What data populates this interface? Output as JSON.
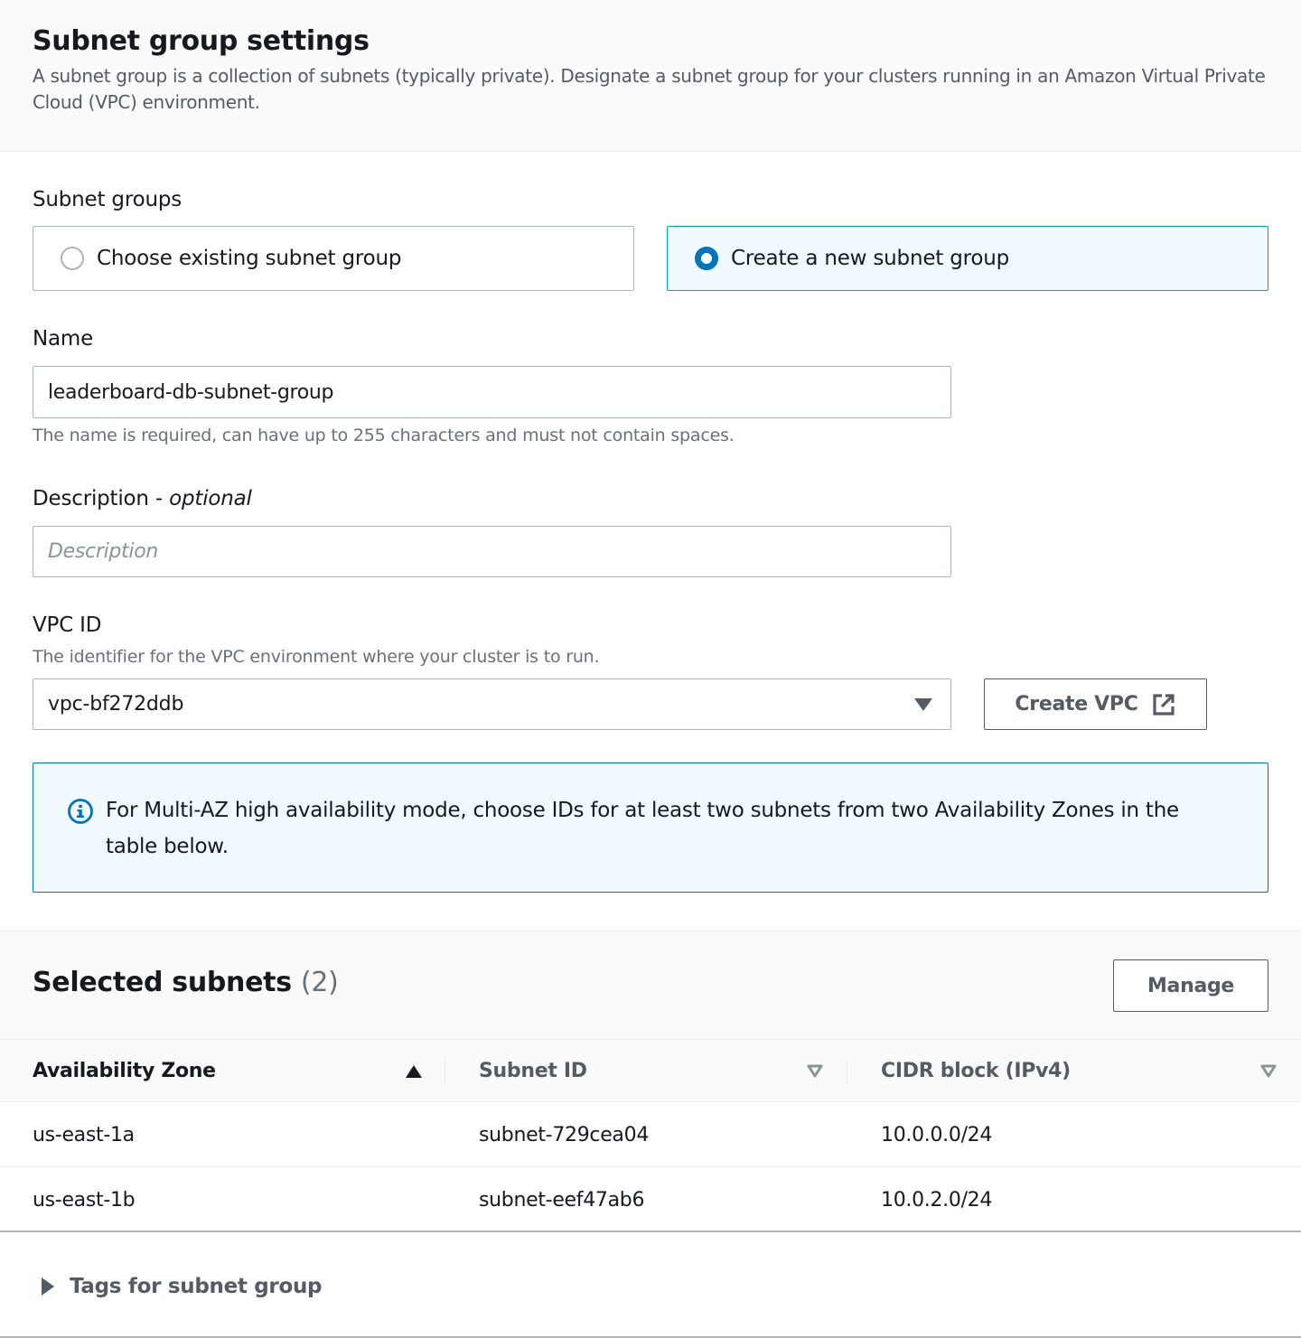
{
  "header": {
    "title": "Subnet group settings",
    "description": "A subnet group is a collection of subnets (typically private). Designate a subnet group for your clusters running in an Amazon Virtual Private Cloud (VPC) environment."
  },
  "subnet_groups": {
    "label": "Subnet groups",
    "options": [
      {
        "label": "Choose existing subnet group",
        "selected": false
      },
      {
        "label": "Create a new subnet group",
        "selected": true
      }
    ]
  },
  "name_field": {
    "label": "Name",
    "value": "leaderboard-db-subnet-group",
    "hint": "The name is required, can have up to 255 characters and must not contain spaces."
  },
  "description_field": {
    "label": "Description - ",
    "label_optional": "optional",
    "value": "",
    "placeholder": "Description"
  },
  "vpc": {
    "label": "VPC ID",
    "hint": "The identifier for the VPC environment where your cluster is to run.",
    "selected": "vpc-bf272ddb",
    "create_button": "Create VPC",
    "create_button_icon": "external-link-icon"
  },
  "info_alert": {
    "icon": "info-icon",
    "text": "For Multi-AZ high availability mode, choose IDs for at least two subnets from two Availability Zones in the table below."
  },
  "selected_subnets": {
    "title": "Selected subnets",
    "count": "(2)",
    "manage_button": "Manage",
    "columns": [
      {
        "label": "Availability Zone",
        "sort": "ascending"
      },
      {
        "label": "Subnet ID",
        "sort": "none"
      },
      {
        "label": "CIDR block (IPv4)",
        "sort": "none"
      }
    ],
    "rows": [
      {
        "az": "us-east-1a",
        "subnet_id": "subnet-729cea04",
        "cidr": "10.0.0.0/24"
      },
      {
        "az": "us-east-1b",
        "subnet_id": "subnet-eef47ab6",
        "cidr": "10.0.2.0/24"
      }
    ]
  },
  "tags": {
    "label": "Tags for subnet group",
    "expanded": false
  },
  "colors": {
    "accent": "#0073bb",
    "selected_tile_bg": "#f1faff",
    "text_primary": "#16191f",
    "text_secondary": "#545b64"
  }
}
